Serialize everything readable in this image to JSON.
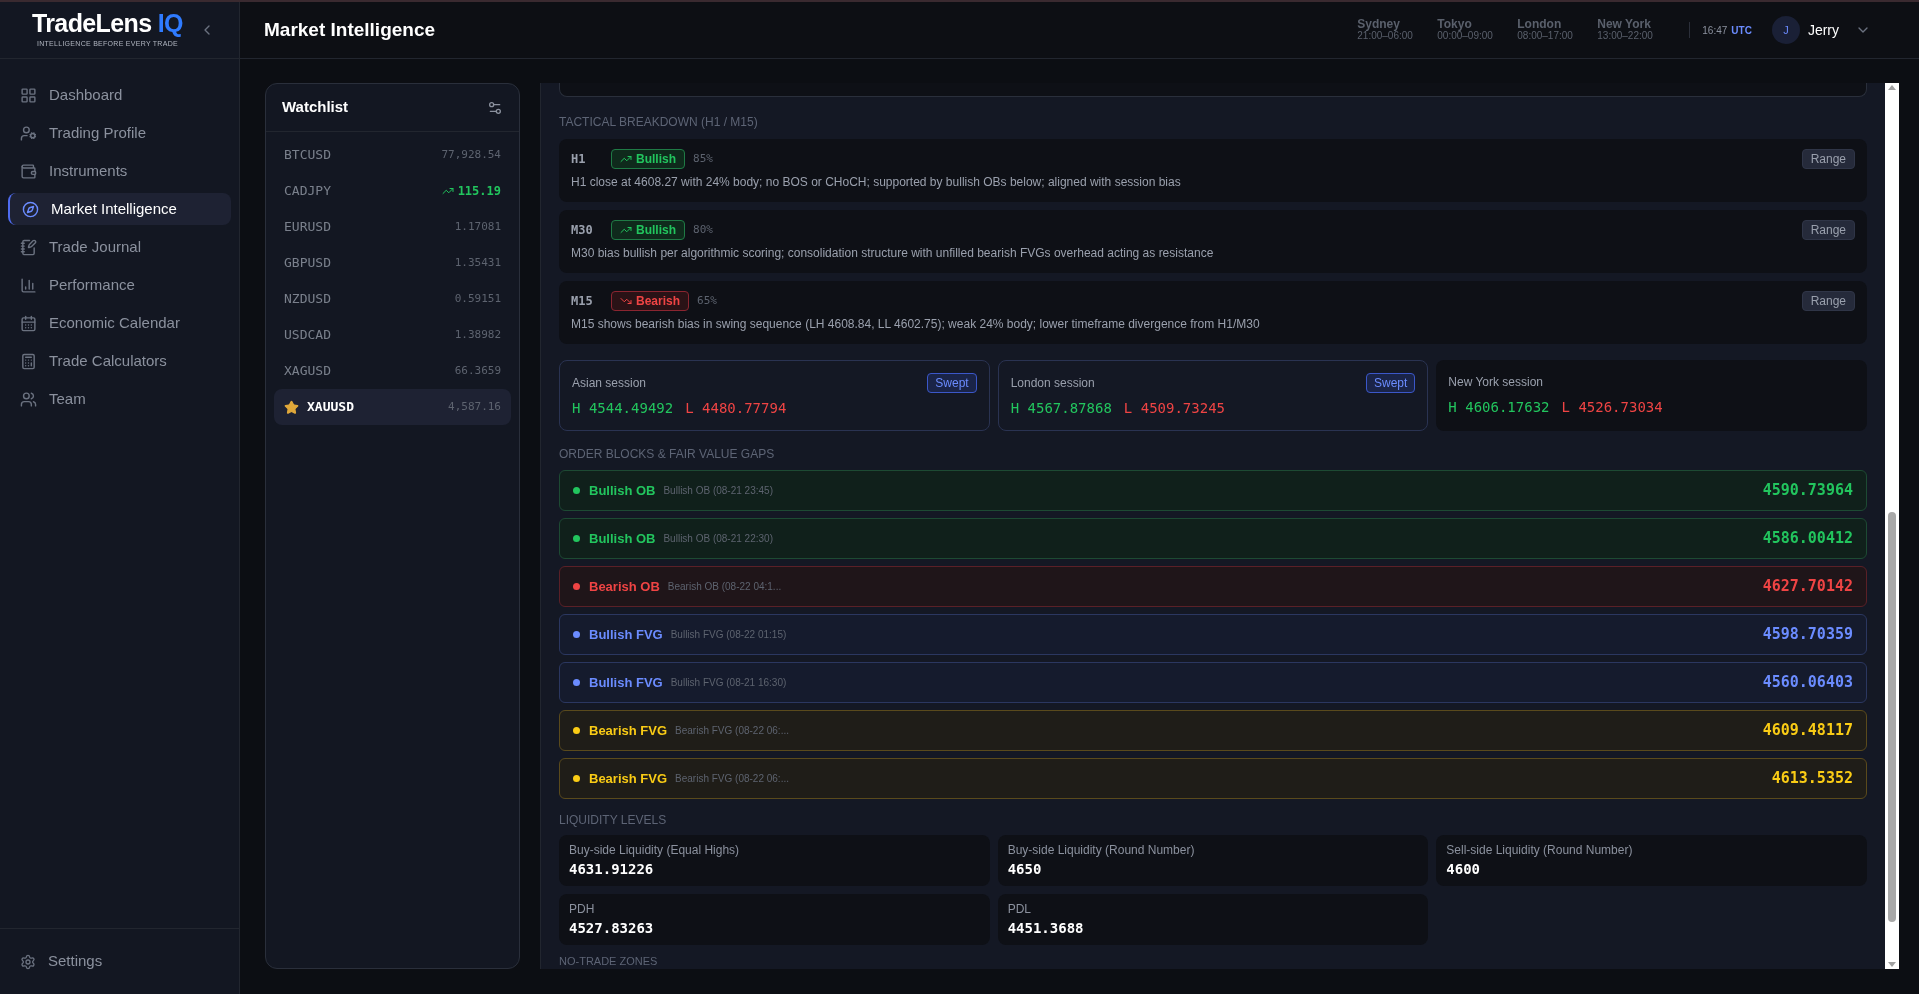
{
  "sidebar": {
    "logo": {
      "name": "TradeLens",
      "accent": "IQ",
      "tagline": "INTELLIGENCE BEFORE EVERY TRADE"
    },
    "items": [
      {
        "label": "Dashboard",
        "selected": false
      },
      {
        "label": "Trading Profile",
        "selected": false
      },
      {
        "label": "Instruments",
        "selected": false
      },
      {
        "label": "Market Intelligence",
        "selected": true
      },
      {
        "label": "Trade Journal",
        "selected": false
      },
      {
        "label": "Performance",
        "selected": false
      },
      {
        "label": "Economic Calendar",
        "selected": false
      },
      {
        "label": "Trade Calculators",
        "selected": false
      },
      {
        "label": "Team",
        "selected": false
      }
    ],
    "footer": {
      "label": "Settings"
    }
  },
  "header": {
    "title": "Market Intelligence",
    "sessions": [
      {
        "city": "Sydney",
        "hours": "21:00–06:00"
      },
      {
        "city": "Tokyo",
        "hours": "00:00–09:00"
      },
      {
        "city": "London",
        "hours": "08:00–17:00"
      },
      {
        "city": "New York",
        "hours": "13:00–22:00"
      }
    ],
    "time": "16:47",
    "timezone": "UTC",
    "user": {
      "initial": "J",
      "name": "Jerry"
    }
  },
  "watchlist": {
    "title": "Watchlist",
    "items": [
      {
        "symbol": "BTCUSD",
        "price": "77,928.54",
        "selected": false,
        "starred": false,
        "rising": false
      },
      {
        "symbol": "CADJPY",
        "price": "115.19",
        "selected": false,
        "starred": false,
        "rising": true
      },
      {
        "symbol": "EURUSD",
        "price": "1.17081",
        "selected": false,
        "starred": false,
        "rising": false
      },
      {
        "symbol": "GBPUSD",
        "price": "1.35431",
        "selected": false,
        "starred": false,
        "rising": false
      },
      {
        "symbol": "NZDUSD",
        "price": "0.59151",
        "selected": false,
        "starred": false,
        "rising": false
      },
      {
        "symbol": "USDCAD",
        "price": "1.38982",
        "selected": false,
        "starred": false,
        "rising": false
      },
      {
        "symbol": "XAGUSD",
        "price": "66.3659",
        "selected": false,
        "starred": false,
        "rising": false
      },
      {
        "symbol": "XAUUSD",
        "price": "4,587.16",
        "selected": true,
        "starred": true,
        "rising": false
      }
    ]
  },
  "tactical": {
    "heading": "TACTICAL BREAKDOWN (H1 / M15)",
    "rows": [
      {
        "timeframe": "H1",
        "kind": "bullish",
        "bias": "Bullish",
        "confidence": "85%",
        "structure": "Range",
        "note": "H1 close at 4608.27 with 24% body; no BOS or CHoCH; supported by bullish OBs below; aligned with session bias"
      },
      {
        "timeframe": "M30",
        "kind": "bullish",
        "bias": "Bullish",
        "confidence": "80%",
        "structure": "Range",
        "note": "M30 bias bullish per algorithmic scoring; consolidation structure with unfilled bearish FVGs overhead acting as resistance"
      },
      {
        "timeframe": "M15",
        "kind": "bearish",
        "bias": "Bearish",
        "confidence": "65%",
        "structure": "Range",
        "note": "M15 shows bearish bias in swing sequence (LH 4608.84, LL 4602.75); weak 24% body; lower timeframe divergence from H1/M30"
      }
    ]
  },
  "sessions": [
    {
      "name": "Asian session",
      "swept": true,
      "badge": "Swept",
      "high_label": "H",
      "high": "4544.49492",
      "low_label": "L",
      "low": "4480.77794"
    },
    {
      "name": "London session",
      "swept": true,
      "badge": "Swept",
      "high_label": "H",
      "high": "4567.87868",
      "low_label": "L",
      "low": "4509.73245"
    },
    {
      "name": "New York session",
      "swept": false,
      "high_label": "H",
      "high": "4606.17632",
      "low_label": "L",
      "low": "4526.73034"
    }
  ],
  "order_blocks": {
    "heading": "ORDER BLOCKS & FAIR VALUE GAPS",
    "items": [
      {
        "kind": "bullish-ob",
        "label": "Bullish OB",
        "detail": "Bullish OB (08-21 23:45)",
        "price": "4590.73964"
      },
      {
        "kind": "bullish-ob",
        "label": "Bullish OB",
        "detail": "Bullish OB (08-21 22:30)",
        "price": "4586.00412"
      },
      {
        "kind": "bearish-ob",
        "label": "Bearish OB",
        "detail": "Bearish OB (08-22 04:1...",
        "price": "4627.70142"
      },
      {
        "kind": "bullish-fvg",
        "label": "Bullish FVG",
        "detail": "Bullish FVG (08-22 01:15)",
        "price": "4598.70359"
      },
      {
        "kind": "bullish-fvg",
        "label": "Bullish FVG",
        "detail": "Bullish FVG (08-21 16:30)",
        "price": "4560.06403"
      },
      {
        "kind": "bearish-fvg",
        "label": "Bearish FVG",
        "detail": "Bearish FVG (08-22 06:...",
        "price": "4609.48117"
      },
      {
        "kind": "bearish-fvg",
        "label": "Bearish FVG",
        "detail": "Bearish FVG (08-22 06:...",
        "price": "4613.5352"
      }
    ]
  },
  "liquidity": {
    "heading": "LIQUIDITY LEVELS",
    "items": [
      {
        "label": "Buy-side Liquidity (Equal Highs)",
        "value": "4631.91226"
      },
      {
        "label": "Buy-side Liquidity (Round Number)",
        "value": "4650"
      },
      {
        "label": "Sell-side Liquidity (Round Number)",
        "value": "4600"
      },
      {
        "label": "PDH",
        "value": "4527.83263"
      },
      {
        "label": "PDL",
        "value": "4451.3688"
      }
    ]
  },
  "next_section": {
    "heading": "NO-TRADE ZONES"
  }
}
